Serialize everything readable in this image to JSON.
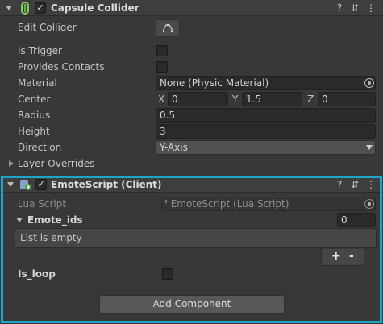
{
  "capsule": {
    "title": "Capsule Collider",
    "enabled_check": "✓",
    "edit_collider_label": "Edit Collider",
    "is_trigger_label": "Is Trigger",
    "provides_contacts_label": "Provides Contacts",
    "material_label": "Material",
    "material_value": "None (Physic Material)",
    "center_label": "Center",
    "center": {
      "x_axis": "X",
      "x": "0",
      "y_axis": "Y",
      "y": "1.5",
      "z_axis": "Z",
      "z": "0"
    },
    "radius_label": "Radius",
    "radius_value": "0.5",
    "height_label": "Height",
    "height_value": "3",
    "direction_label": "Direction",
    "direction_value": "Y-Axis",
    "layer_overrides_label": "Layer Overrides"
  },
  "emote": {
    "title": "EmoteScript  (Client)",
    "enabled_check": "✓",
    "lua_script_label": "Lua Script",
    "lua_script_value": "EmoteScript (Lua Script)",
    "emote_ids_label": "Emote_ids",
    "emote_ids_count": "0",
    "list_empty_text": "List is empty",
    "add_label": "+",
    "remove_label": "-",
    "is_loop_label": "Is_loop"
  },
  "add_component_label": "Add Component",
  "header_icons": {
    "help": "?",
    "presets": "⇵",
    "menu": "⋮"
  },
  "colors": {
    "highlight": "#1ea4c8",
    "background": "#383838",
    "field": "#2a2a2a"
  }
}
